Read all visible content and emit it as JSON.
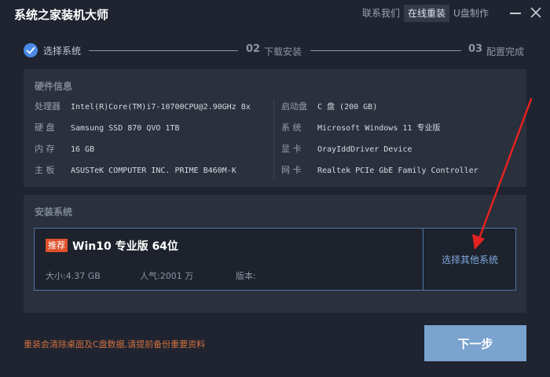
{
  "app": {
    "title": "系统之家装机大师"
  },
  "nav": [
    {
      "label": "联系我们",
      "active": false
    },
    {
      "label": "在线重装",
      "active": true
    },
    {
      "label": "U盘制作",
      "active": false
    }
  ],
  "steps": {
    "step1": {
      "label": "选择系统"
    },
    "step2": {
      "num": "02",
      "label": "下载安装"
    },
    "step3": {
      "num": "03",
      "label": "配置完成"
    }
  },
  "hardware": {
    "title": "硬件信息",
    "left": [
      {
        "key": "处理器",
        "value": "Intel(R)Core(TM)i7-10700CPU@2.90GHz 8x"
      },
      {
        "key": "硬  盘",
        "value": "Samsung SSD 870 QVO 1TB"
      },
      {
        "key": "内  存",
        "value": "16 GB"
      },
      {
        "key": "主  板",
        "value": "ASUSTeK COMPUTER INC. PRIME B460M-K"
      }
    ],
    "right": [
      {
        "key": "启动盘",
        "value": "C 盘 (200 GB)"
      },
      {
        "key": "系  统",
        "value": "Microsoft Windows 11 专业版"
      },
      {
        "key": "显  卡",
        "value": "OrayIddDriver Device"
      },
      {
        "key": "网  卡",
        "value": "Realtek PCIe GbE Family Controller"
      }
    ]
  },
  "install": {
    "title": "安装系统",
    "badge": "推荐",
    "os_name": "Win10 专业版 64位",
    "size": "大小:4.37 GB",
    "popularity": "人气:2001 万",
    "version": "版本:",
    "select_other": "选择其他系统"
  },
  "footer": {
    "warning": "重装会清除桌面及C盘数据,请提前备份重要资料",
    "next": "下一步"
  },
  "colors": {
    "background": "#1f2430",
    "panel": "#2a303c",
    "accent": "#4a8ae6",
    "badge": "#e0502d",
    "warning": "#d2703f",
    "next_button": "#7aa3cf",
    "annotation_arrow": "#e52222"
  },
  "icons": {
    "step1": "check-circle-icon",
    "minimize": "minimize-icon",
    "close": "close-icon",
    "annotation": "red-arrow-icon"
  }
}
